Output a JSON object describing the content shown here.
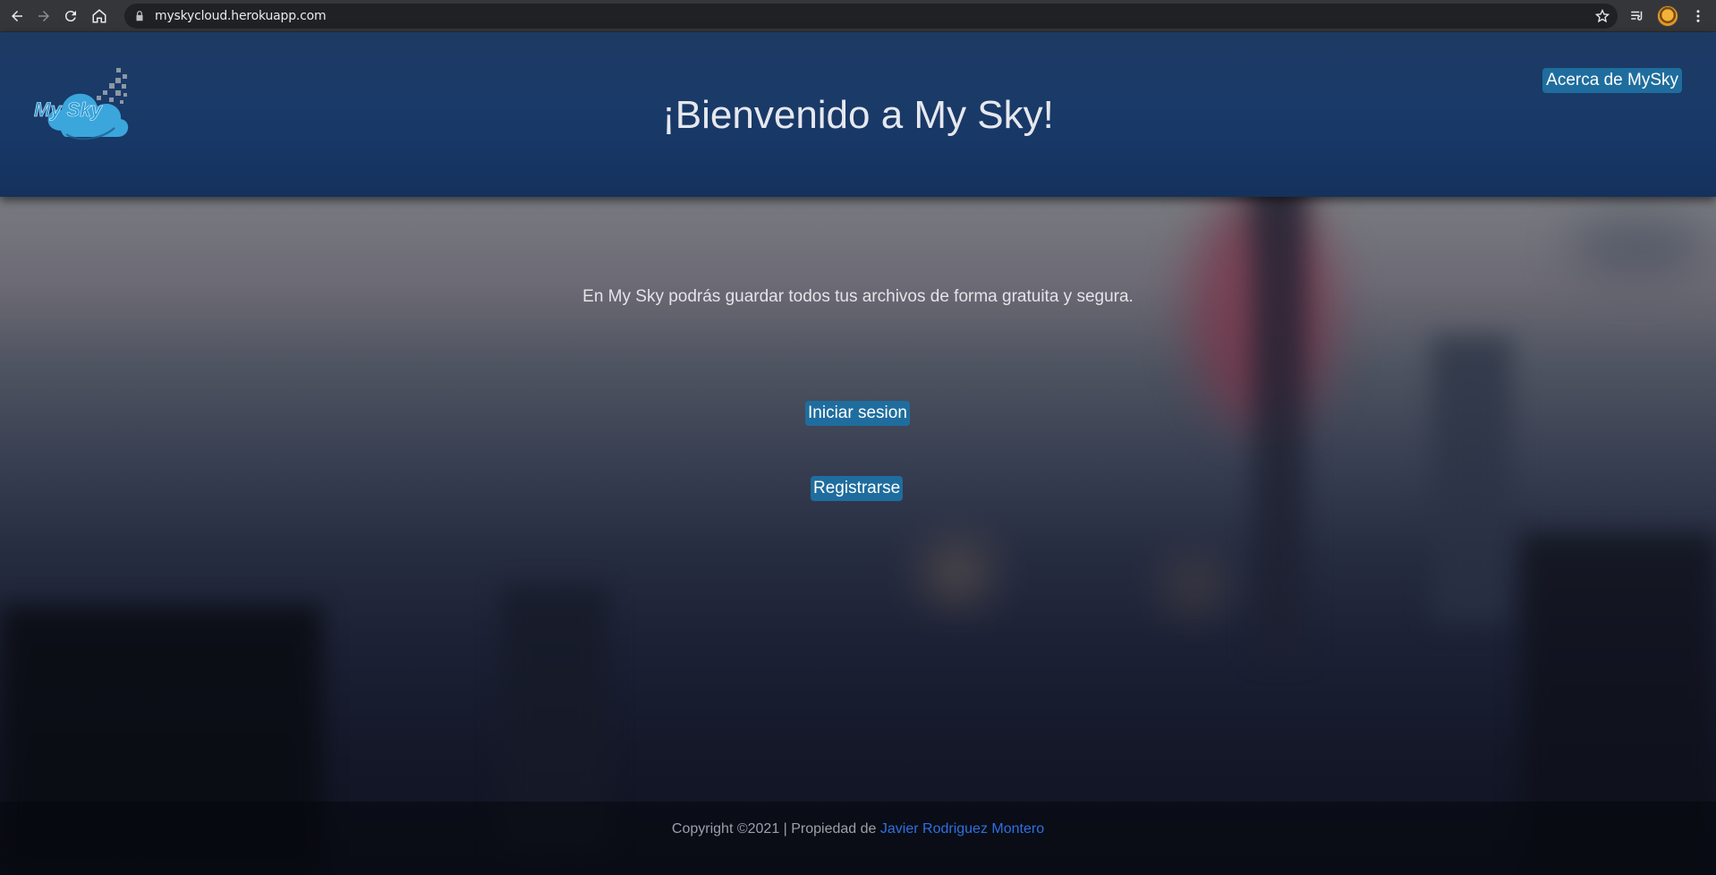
{
  "browser": {
    "url": "myskycloud.herokuapp.com"
  },
  "header": {
    "logo_text": "My Sky",
    "title": "¡Bienvenido a My Sky!",
    "about_label": "Acerca de MySky"
  },
  "main": {
    "tagline": "En My Sky podrás guardar todos tus archivos de forma gratuita y segura.",
    "login_label": "Iniciar sesion",
    "register_label": "Registrarse"
  },
  "footer": {
    "copyright": "Copyright ©2021 | Propiedad de ",
    "author_link": "Javier Rodriguez Montero"
  },
  "colors": {
    "header_bg": "#1a3a68",
    "button_bg": "#1f6d9e",
    "link": "#2f6fe0"
  }
}
